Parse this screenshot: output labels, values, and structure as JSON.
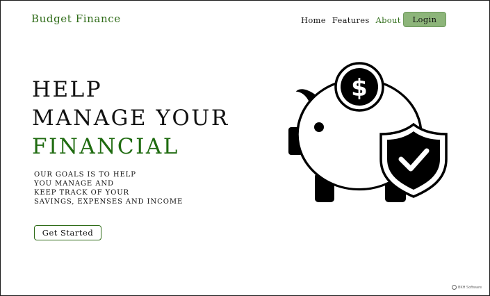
{
  "header": {
    "brand": "Budget Finance",
    "nav": [
      {
        "label": "Home",
        "active": false
      },
      {
        "label": "Features",
        "active": false
      },
      {
        "label": "About",
        "active": true
      }
    ],
    "login_label": "Login"
  },
  "hero": {
    "title_lines": [
      "HELP",
      "MANAGE YOUR"
    ],
    "title_accent": "FINANCIAL",
    "description_lines": [
      "OUR GOALS IS TO HELP",
      "YOU MANAGE AND",
      "KEEP TRACK OF YOUR",
      "SAVINGS, EXPENSES AND INCOME"
    ],
    "cta_label": "Get Started"
  },
  "illustration": {
    "icons": [
      "piggy-bank-icon",
      "dollar-coin-icon",
      "shield-check-icon"
    ]
  },
  "footer": {
    "credit": "BKH Software"
  },
  "colors": {
    "brand_green": "#2e6b17",
    "accent_green": "#1f6b10",
    "login_bg": "#8db57a",
    "text": "#111111"
  }
}
